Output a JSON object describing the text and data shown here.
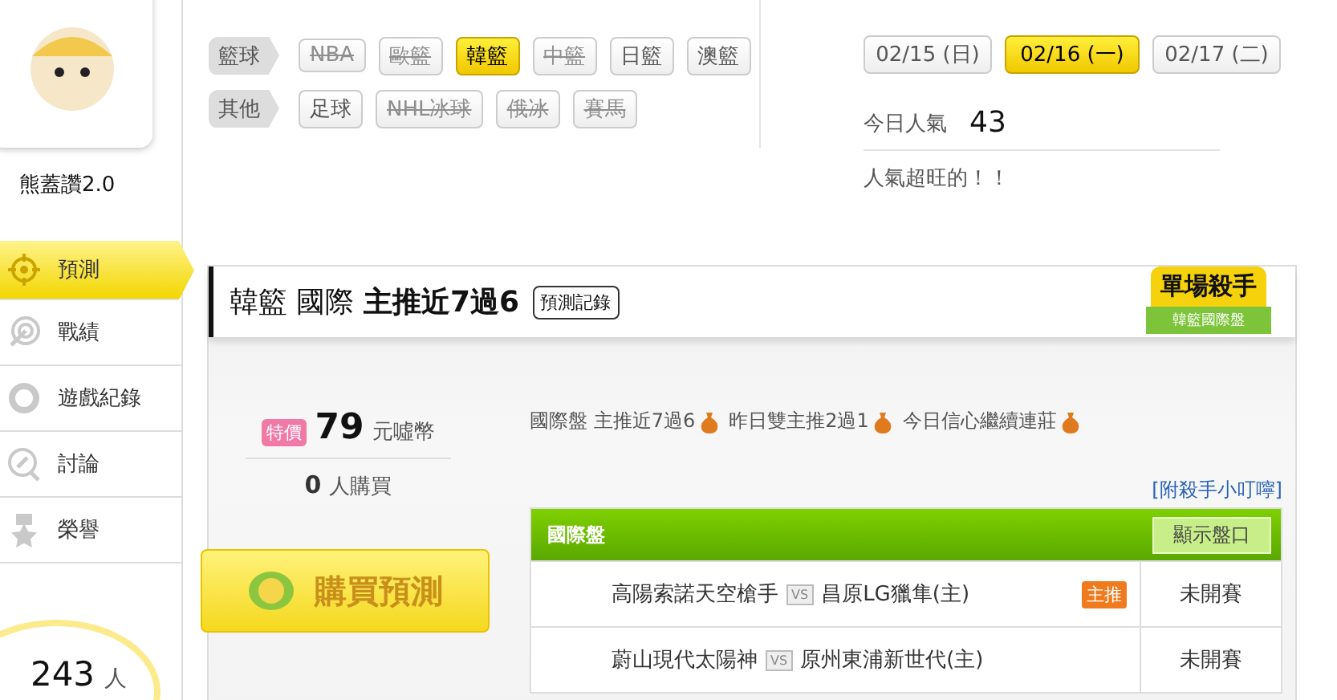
{
  "profile": {
    "name": "熊蓋讚2.0"
  },
  "nav": [
    {
      "label": "預測",
      "selected": true
    },
    {
      "label": "戰績",
      "selected": false
    },
    {
      "label": "遊戲紀錄",
      "selected": false
    },
    {
      "label": "討論",
      "selected": false
    },
    {
      "label": "榮譽",
      "selected": false
    }
  ],
  "visitors": {
    "count": "243",
    "unit": "人"
  },
  "filters": [
    {
      "label": "籃球",
      "options": [
        {
          "label": "NBA",
          "selected": false,
          "disabled": true
        },
        {
          "label": "歐籃",
          "selected": false,
          "disabled": true
        },
        {
          "label": "韓籃",
          "selected": true,
          "disabled": false
        },
        {
          "label": "中籃",
          "selected": false,
          "disabled": true
        },
        {
          "label": "日籃",
          "selected": false,
          "disabled": false
        },
        {
          "label": "澳籃",
          "selected": false,
          "disabled": false
        }
      ]
    },
    {
      "label": "其他",
      "options": [
        {
          "label": "足球",
          "selected": false,
          "disabled": false
        },
        {
          "label": "NHL冰球",
          "selected": false,
          "disabled": true
        },
        {
          "label": "俄冰",
          "selected": false,
          "disabled": true
        },
        {
          "label": "賽馬",
          "selected": false,
          "disabled": true
        }
      ]
    }
  ],
  "dates": {
    "options": [
      {
        "label": "02/15 (日)",
        "selected": false
      },
      {
        "label": "02/16 (一)",
        "selected": true
      },
      {
        "label": "02/17 (二)",
        "selected": false
      }
    ]
  },
  "popularity": {
    "label": "今日人氣",
    "value": "43",
    "note": "人氣超旺的！！"
  },
  "prediction": {
    "title_prefix": "韓籃 國際",
    "title_main": "主推近7過6",
    "history_button": "預測記錄",
    "badge": {
      "title": "單場殺手",
      "subtitle": "韓籃國際盤"
    },
    "price_tag": "特價",
    "price": "79",
    "currency": "元噓幣",
    "buyers": "0",
    "buyers_label": "人購買",
    "buy_button": "購買預測",
    "highlights": [
      "國際盤 主推近7過6",
      "昨日雙主推2過1",
      "今日信心繼續連莊"
    ],
    "tips_link": "[附殺手小叮嚀]",
    "table": {
      "title": "國際盤",
      "toggle_button": "顯示盤口",
      "rows": [
        {
          "home": "高陽索諾天空槍手",
          "vs": "VS",
          "away": "昌原LG獵隼(主)",
          "pick": "主推",
          "status": "未開賽"
        },
        {
          "home": "蔚山現代太陽神",
          "vs": "VS",
          "away": "原州東浦新世代(主)",
          "status": "未開賽"
        }
      ]
    }
  }
}
